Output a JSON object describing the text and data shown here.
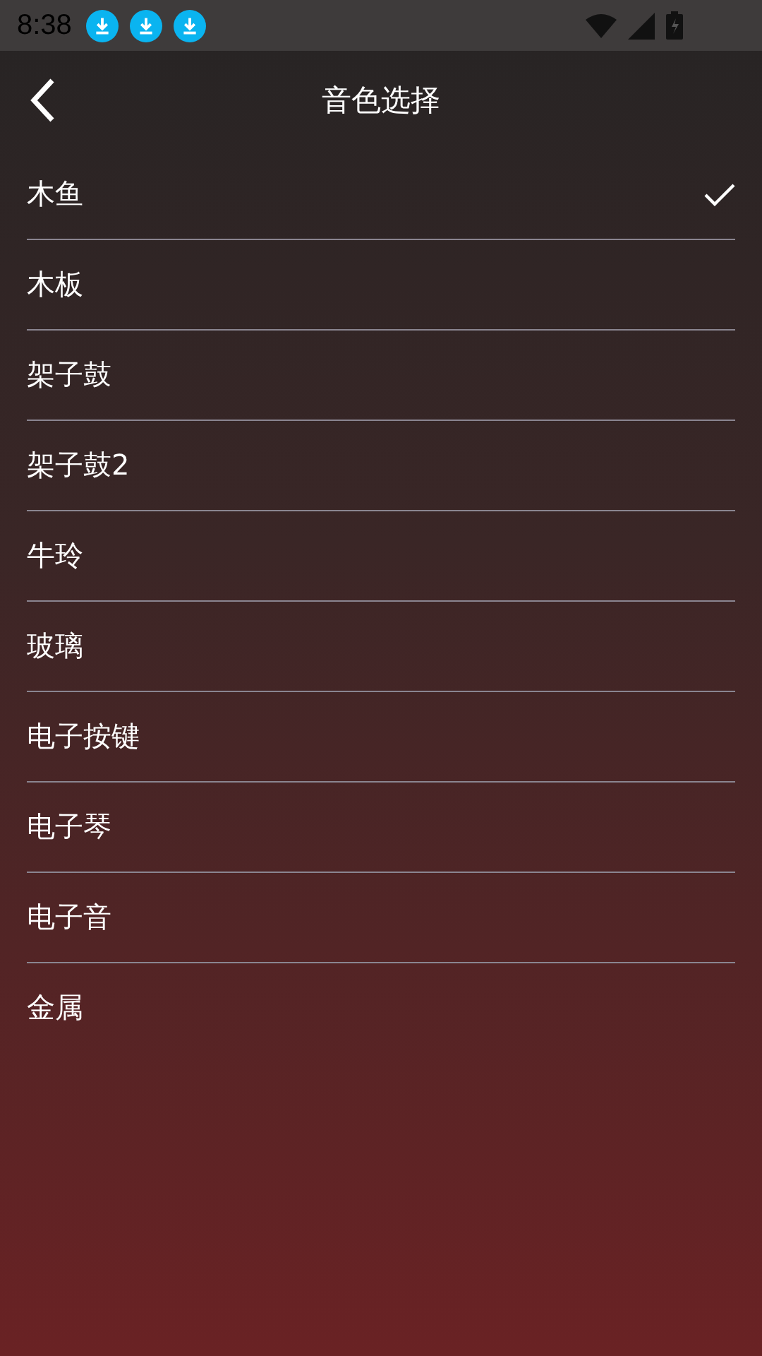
{
  "status_bar": {
    "time": "8:38",
    "notifications": [
      {
        "kind": "download"
      },
      {
        "kind": "download"
      },
      {
        "kind": "download"
      }
    ]
  },
  "header": {
    "title": "音色选择"
  },
  "items": [
    {
      "label": "木鱼",
      "selected": true
    },
    {
      "label": "木板",
      "selected": false
    },
    {
      "label": "架子鼓",
      "selected": false
    },
    {
      "label": "架子鼓2",
      "selected": false
    },
    {
      "label": "牛玲",
      "selected": false
    },
    {
      "label": "玻璃",
      "selected": false
    },
    {
      "label": "电子按键",
      "selected": false
    },
    {
      "label": "电子琴",
      "selected": false
    },
    {
      "label": "电子音",
      "selected": false
    },
    {
      "label": "金属",
      "selected": false
    }
  ]
}
